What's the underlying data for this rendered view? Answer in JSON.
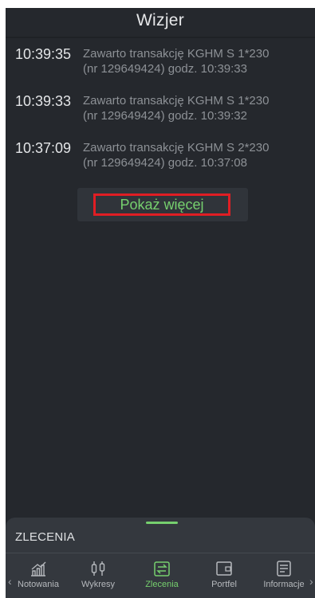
{
  "header": {
    "title": "Wizjer"
  },
  "events": [
    {
      "time": "10:39:35",
      "line1": "Zawarto transakcję  KGHM S 1*230",
      "line2": "(nr 129649424) godz. 10:39:33"
    },
    {
      "time": "10:39:33",
      "line1": "Zawarto transakcję  KGHM S 1*230",
      "line2": "(nr 129649424) godz. 10:39:32"
    },
    {
      "time": "10:37:09",
      "line1": "Zawarto transakcję  KGHM S 2*230",
      "line2": "(nr 129649424) godz. 10:37:08"
    }
  ],
  "show_more": {
    "label": "Pokaż więcej"
  },
  "bottom_sheet": {
    "title": "ZLECENIA"
  },
  "nav": {
    "left_chevron": "‹",
    "right_chevron": "›",
    "items": [
      {
        "label": "Notowania",
        "icon": "chart-icon",
        "active": false
      },
      {
        "label": "Wykresy",
        "icon": "candlestick-icon",
        "active": false
      },
      {
        "label": "Zlecenia",
        "icon": "swap-icon",
        "active": true
      },
      {
        "label": "Portfel",
        "icon": "wallet-icon",
        "active": false
      },
      {
        "label": "Informacje",
        "icon": "news-icon",
        "active": false
      }
    ]
  },
  "colors": {
    "accent": "#76d06e",
    "background": "#25282d",
    "highlight_border": "#e01e24"
  }
}
